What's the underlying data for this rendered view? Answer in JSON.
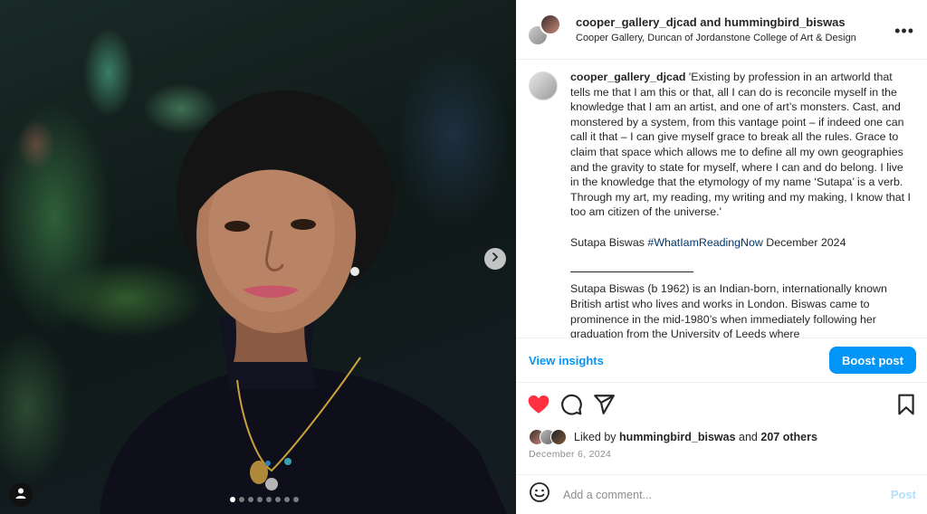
{
  "post": {
    "header": {
      "usernames_line": "cooper_gallery_djcad and hummingbird_biswas",
      "location": "Cooper Gallery, Duncan of Jordanstone College of Art & Design"
    },
    "caption": {
      "username": "cooper_gallery_djcad",
      "quote": "'Existing by profession in an artworld that tells me that I am this or that, all I can do is reconcile myself in the knowledge that I am an artist, and one of art’s monsters. Cast, and monstered by a system, from this vantage point – if indeed one can call it that – I can give myself grace to break all the rules. Grace to claim that space which allows me to define all my own geographies and the gravity to state for myself, where I can and do belong. I live in the knowledge that the etymology of my name ‘Sutapa’ is a verb. Through my art, my reading, my writing and my making, I know that I too am citizen of the universe.'",
      "signoff_prefix": "Sutapa Biswas",
      "hashtag": "#WhatIamReadingNow",
      "signoff_suffix": "December 2024",
      "bio": "Sutapa Biswas (b 1962) is an Indian-born, internationally known British artist who lives and works in London. Biswas came to prominence in the mid-1980’s when immediately following her graduation from the University of Leeds where"
    },
    "view_insights_label": "View insights",
    "boost_label": "Boost post",
    "likes": {
      "prefix": "Liked by",
      "user": "hummingbird_biswas",
      "middle": "and",
      "others": "207 others"
    },
    "date": "December 6, 2024",
    "comment": {
      "placeholder": "Add a comment...",
      "post_label": "Post"
    }
  },
  "carousel": {
    "total": 8,
    "active_index": 0
  },
  "colors": {
    "like_red": "#ff3040",
    "link_blue": "#0095f6",
    "hashtag_blue": "#00376b"
  },
  "icons": [
    "chevron-right-icon",
    "user-tag-icon",
    "more-options-icon",
    "heart-icon",
    "comment-icon",
    "share-icon",
    "bookmark-icon",
    "emoji-icon"
  ]
}
